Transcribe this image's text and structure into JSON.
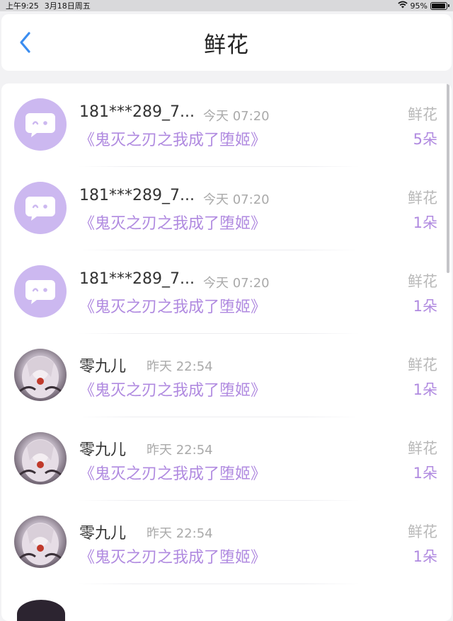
{
  "status_bar": {
    "time": "上午9:25",
    "date": "3月18日周五",
    "battery": "95%",
    "battery_level": 0.95
  },
  "header": {
    "title": "鲜花",
    "back_icon": "chevron-left-icon",
    "accent_color": "#3b8df0"
  },
  "colors": {
    "purple": "#b08ae0",
    "avatar_bg": "#ccb8f0"
  },
  "gifts": [
    {
      "user": "181***289_7...",
      "time": "今天 07:20",
      "book": "《鬼灭之刃之我成了堕姬》",
      "type": "鲜花",
      "count": "5朵",
      "avatar": "default-avatar"
    },
    {
      "user": "181***289_7...",
      "time": "今天 07:20",
      "book": "《鬼灭之刃之我成了堕姬》",
      "type": "鲜花",
      "count": "1朵",
      "avatar": "default-avatar"
    },
    {
      "user": "181***289_7...",
      "time": "今天 07:20",
      "book": "《鬼灭之刃之我成了堕姬》",
      "type": "鲜花",
      "count": "1朵",
      "avatar": "default-avatar"
    },
    {
      "user": "零九儿",
      "time": "昨天 22:54",
      "book": "《鬼灭之刃之我成了堕姬》",
      "type": "鲜花",
      "count": "1朵",
      "avatar": "anime-avatar"
    },
    {
      "user": "零九儿",
      "time": "昨天 22:54",
      "book": "《鬼灭之刃之我成了堕姬》",
      "type": "鲜花",
      "count": "1朵",
      "avatar": "anime-avatar"
    },
    {
      "user": "零九儿",
      "time": "昨天 22:54",
      "book": "《鬼灭之刃之我成了堕姬》",
      "type": "鲜花",
      "count": "1朵",
      "avatar": "anime-avatar"
    }
  ]
}
